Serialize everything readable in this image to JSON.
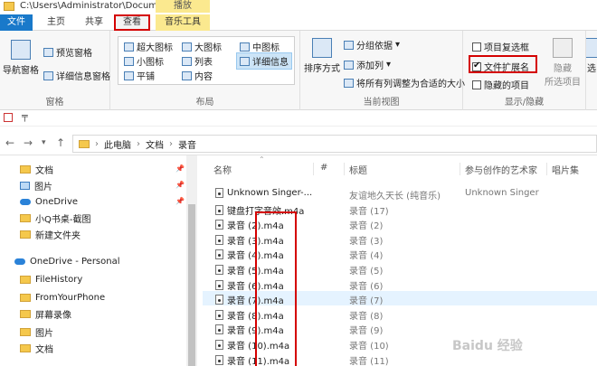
{
  "titlebar": {
    "path": "C:\\Users\\Administrator\\Docum...",
    "context_tab": "播放"
  },
  "tabs": {
    "file": "文件",
    "home": "主页",
    "share": "共享",
    "view": "查看",
    "music": "音乐工具"
  },
  "ribbon": {
    "panes": {
      "nav_pane": "导航窗格",
      "preview_pane": "预览窗格",
      "details_pane": "详细信息窗格",
      "label": "窗格"
    },
    "layout": {
      "extra_large": "超大图标",
      "large": "大图标",
      "medium": "中图标",
      "small": "小图标",
      "list": "列表",
      "details": "详细信息",
      "tiles": "平铺",
      "content": "内容",
      "label": "布局"
    },
    "current_view": {
      "sort_by": "排序方式",
      "group_by": "分组依据",
      "add_columns": "添加列",
      "size_all": "将所有列调整为合适的大小",
      "label": "当前视图"
    },
    "show_hide": {
      "item_checkboxes": "项目复选框",
      "file_extensions": "文件扩展名",
      "hidden_items": "隐藏的项目",
      "hide": "隐藏",
      "hide_selected": "所选项目",
      "label": "显示/隐藏",
      "options": "选",
      "item_checkboxes_checked": false,
      "file_extensions_checked": true,
      "hidden_items_checked": false
    }
  },
  "address": {
    "crumbs": [
      "此电脑",
      "文档",
      "录音"
    ]
  },
  "sidebar": {
    "items": [
      {
        "label": "文档",
        "icon": "document-folder-icon",
        "pinned": true
      },
      {
        "label": "图片",
        "icon": "pictures-icon",
        "pinned": true
      },
      {
        "label": "OneDrive",
        "icon": "onedrive-cloud-icon",
        "pinned": true
      },
      {
        "label": "小Q书桌-截图",
        "icon": "folder-icon"
      },
      {
        "label": "新建文件夹",
        "icon": "folder-icon"
      },
      {
        "label": "OneDrive - Personal",
        "icon": "onedrive-cloud-icon"
      },
      {
        "label": "FileHistory",
        "icon": "folder-icon"
      },
      {
        "label": "FromYourPhone",
        "icon": "folder-icon"
      },
      {
        "label": "屏幕录像",
        "icon": "folder-icon"
      },
      {
        "label": "图片",
        "icon": "folder-icon"
      },
      {
        "label": "文档",
        "icon": "folder-icon"
      }
    ]
  },
  "list": {
    "columns": {
      "name": "名称",
      "number": "#",
      "title": "标题",
      "artist": "参与创作的艺术家",
      "album": "唱片集"
    },
    "rows": [
      {
        "name": "Unknown Singer-...",
        "title": "友谊地久天长 (纯音乐)",
        "artist": "Unknown Singer"
      },
      {
        "name": "键盘打字音效.m4a",
        "title": "录音 (17)",
        "artist": ""
      },
      {
        "name": "录音 (2).m4a",
        "title": "录音 (2)",
        "artist": ""
      },
      {
        "name": "录音 (3).m4a",
        "title": "录音 (3)",
        "artist": ""
      },
      {
        "name": "录音 (4).m4a",
        "title": "录音 (4)",
        "artist": ""
      },
      {
        "name": "录音 (5).m4a",
        "title": "录音 (5)",
        "artist": ""
      },
      {
        "name": "录音 (6).m4a",
        "title": "录音 (6)",
        "artist": ""
      },
      {
        "name": "录音 (7).m4a",
        "title": "录音 (7)",
        "artist": ""
      },
      {
        "name": "录音 (8).m4a",
        "title": "录音 (8)",
        "artist": ""
      },
      {
        "name": "录音 (9).m4a",
        "title": "录音 (9)",
        "artist": ""
      },
      {
        "name": "录音 (10).m4a",
        "title": "录音 (10)",
        "artist": ""
      },
      {
        "name": "录音 (11).m4a",
        "title": "录音 (11)",
        "artist": ""
      }
    ]
  },
  "watermark": "Baidu 经验"
}
